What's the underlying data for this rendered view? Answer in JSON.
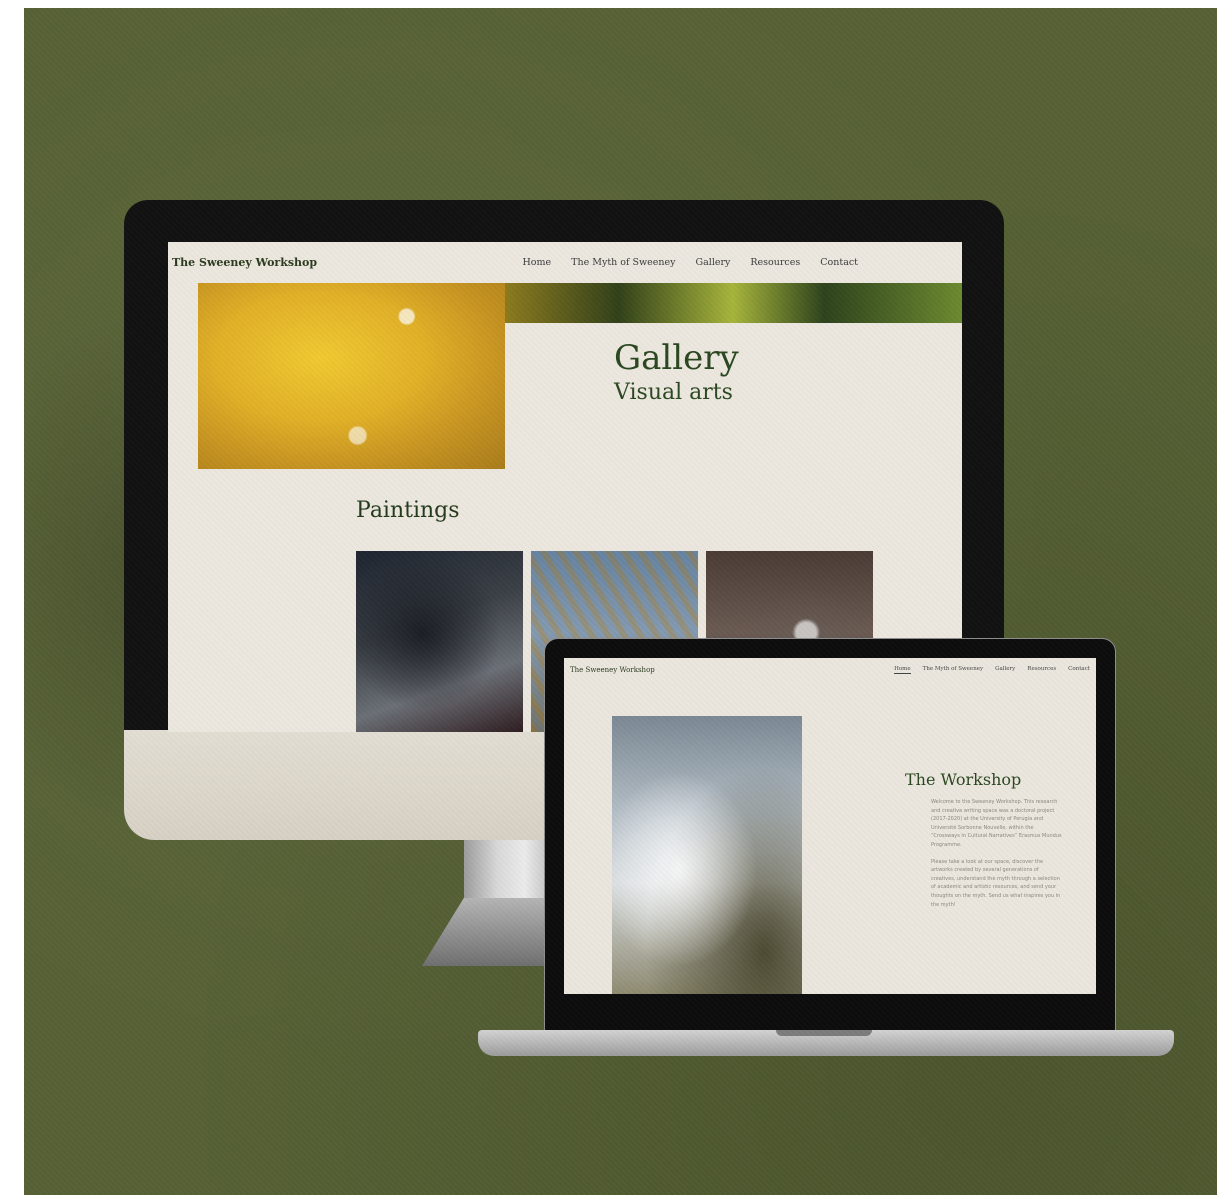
{
  "imac": {
    "brand": "The Sweeney Workshop",
    "nav": [
      "Home",
      "The Myth of Sweeney",
      "Gallery",
      "Resources",
      "Contact"
    ],
    "gallery_title": "Gallery",
    "gallery_subtitle": "Visual arts",
    "paintings_heading": "Paintings"
  },
  "laptop": {
    "brand": "The Sweeney Workshop",
    "nav": [
      "Home",
      "The Myth of Sweeney",
      "Gallery",
      "Resources",
      "Contact"
    ],
    "active_nav": "Home",
    "section_title": "The Workshop",
    "body_paragraph_1": "Welcome to the Sweeney Workshop. This research and creative writing space was a doctoral project (2017-2020) at the University of Perugia and Université Sorbonne Nouvelle, within the “Crossways in Cultural Narratives” Erasmus Mundus Programme.",
    "body_paragraph_2": "Please take a look at our space, discover the artworks created by several generations of creatives, understand the myth through a selection of academic and artistic resources, and send your thoughts on the myth. Send us what inspires you in the myth!"
  }
}
